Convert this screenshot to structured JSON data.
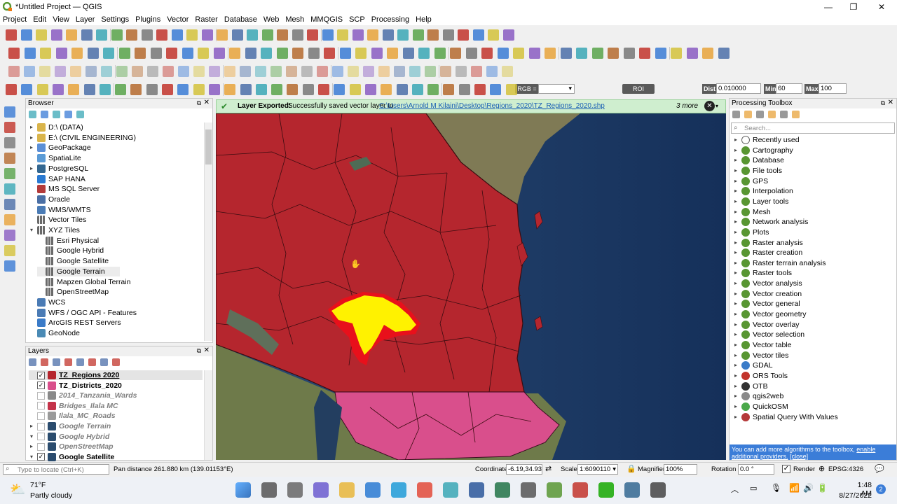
{
  "window": {
    "title": "*Untitled Project — QGIS",
    "minimize": "—",
    "maximize": "❐",
    "close": "✕"
  },
  "menu": [
    "Project",
    "Edit",
    "View",
    "Layer",
    "Settings",
    "Plugins",
    "Vector",
    "Raster",
    "Database",
    "Web",
    "Mesh",
    "MMQGIS",
    "SCP",
    "Processing",
    "Help"
  ],
  "toolbar": {
    "rgb_label": "RGB =",
    "roi_label": "ROI",
    "dist_label": "Dist",
    "dist_value": "0.010000",
    "min_label": "Min",
    "min_value": "60",
    "max_label": "Max",
    "max_value": "100"
  },
  "browser": {
    "title": "Browser",
    "items": [
      {
        "label": "D:\\ (DATA)",
        "icon": "folder-icon",
        "arrow": "▸",
        "indent": 0
      },
      {
        "label": "E:\\ (CIVIL ENGINEERING)",
        "icon": "folder-icon",
        "arrow": "▸",
        "indent": 0
      },
      {
        "label": "GeoPackage",
        "icon": "geopackage-icon",
        "arrow": "▸",
        "indent": 0
      },
      {
        "label": "SpatiaLite",
        "icon": "spatialite-icon",
        "arrow": "",
        "indent": 0
      },
      {
        "label": "PostgreSQL",
        "icon": "postgresql-icon",
        "arrow": "▸",
        "indent": 0
      },
      {
        "label": "SAP HANA",
        "icon": "sap-hana-icon",
        "arrow": "",
        "indent": 0
      },
      {
        "label": "MS SQL Server",
        "icon": "mssql-icon",
        "arrow": "",
        "indent": 0
      },
      {
        "label": "Oracle",
        "icon": "oracle-icon",
        "arrow": "",
        "indent": 0
      },
      {
        "label": "WMS/WMTS",
        "icon": "wms-icon",
        "arrow": "",
        "indent": 0
      },
      {
        "label": "Vector Tiles",
        "icon": "vector-tiles-icon",
        "arrow": "",
        "indent": 0
      },
      {
        "label": "XYZ Tiles",
        "icon": "xyz-tiles-icon",
        "arrow": "▾",
        "indent": 0
      },
      {
        "label": "Esri Physical",
        "icon": "tile-grid-icon",
        "arrow": "",
        "indent": 1
      },
      {
        "label": "Google Hybrid",
        "icon": "tile-grid-icon",
        "arrow": "",
        "indent": 1
      },
      {
        "label": "Google Satellite",
        "icon": "tile-grid-icon",
        "arrow": "",
        "indent": 1
      },
      {
        "label": "Google Terrain",
        "icon": "tile-grid-icon",
        "arrow": "",
        "indent": 1
      },
      {
        "label": "Mapzen Global Terrain",
        "icon": "tile-grid-icon",
        "arrow": "",
        "indent": 1
      },
      {
        "label": "OpenStreetMap",
        "icon": "tile-grid-icon",
        "arrow": "",
        "indent": 1
      },
      {
        "label": "WCS",
        "icon": "wcs-icon",
        "arrow": "",
        "indent": 0
      },
      {
        "label": "WFS / OGC API - Features",
        "icon": "wfs-icon",
        "arrow": "",
        "indent": 0
      },
      {
        "label": "ArcGIS REST Servers",
        "icon": "arcgis-icon",
        "arrow": "",
        "indent": 0
      },
      {
        "label": "GeoNode",
        "icon": "geonode-icon",
        "arrow": "",
        "indent": 0
      }
    ]
  },
  "layers": {
    "title": "Layers",
    "items": [
      {
        "label": "TZ_Regions 2020",
        "checked": true,
        "bold": true,
        "italic": false,
        "color": "#b5262e",
        "arrow": ""
      },
      {
        "label": "TZ_Districts_2020",
        "checked": true,
        "bold": true,
        "italic": false,
        "color": "#d94f8c",
        "arrow": ""
      },
      {
        "label": "2014_Tanzania_Wards",
        "checked": false,
        "bold": true,
        "italic": true,
        "color": "#8a8a8a",
        "arrow": ""
      },
      {
        "label": "Bridges_Ilala MC",
        "checked": false,
        "bold": true,
        "italic": true,
        "color": "#c4334a",
        "arrow": ""
      },
      {
        "label": "Ilala_MC_Roads",
        "checked": false,
        "bold": true,
        "italic": true,
        "color": "#9a9a9a",
        "arrow": ""
      },
      {
        "label": "Google Terrain",
        "checked": false,
        "bold": true,
        "italic": true,
        "color": "#2b4c6e",
        "arrow": "▸"
      },
      {
        "label": "Google Hybrid",
        "checked": false,
        "bold": true,
        "italic": true,
        "color": "#2b4c6e",
        "arrow": "▾"
      },
      {
        "label": "OpenStreetMap",
        "checked": false,
        "bold": true,
        "italic": true,
        "color": "#2b4c6e",
        "arrow": "▸"
      },
      {
        "label": "Google Satellite",
        "checked": true,
        "bold": true,
        "italic": false,
        "color": "#2b4c6e",
        "arrow": "▾"
      }
    ]
  },
  "message": {
    "title": "Layer Exported:",
    "text": "Successfully saved vector layer to",
    "link": "C:\\Users\\Arnold M Kilaini\\Desktop\\Regions_2020\\TZ_Regions_2020.shp",
    "more": "3 more"
  },
  "processing": {
    "title": "Processing Toolbox",
    "search_placeholder": "Search...",
    "items": [
      {
        "label": "Recently used",
        "icon": "clock-icon"
      },
      {
        "label": "Cartography",
        "icon": "qgis-icon"
      },
      {
        "label": "Database",
        "icon": "qgis-icon"
      },
      {
        "label": "File tools",
        "icon": "qgis-icon"
      },
      {
        "label": "GPS",
        "icon": "qgis-icon"
      },
      {
        "label": "Interpolation",
        "icon": "qgis-icon"
      },
      {
        "label": "Layer tools",
        "icon": "qgis-icon"
      },
      {
        "label": "Mesh",
        "icon": "qgis-icon"
      },
      {
        "label": "Network analysis",
        "icon": "qgis-icon"
      },
      {
        "label": "Plots",
        "icon": "qgis-icon"
      },
      {
        "label": "Raster analysis",
        "icon": "qgis-icon"
      },
      {
        "label": "Raster creation",
        "icon": "qgis-icon"
      },
      {
        "label": "Raster terrain analysis",
        "icon": "qgis-icon"
      },
      {
        "label": "Raster tools",
        "icon": "qgis-icon"
      },
      {
        "label": "Vector analysis",
        "icon": "qgis-icon"
      },
      {
        "label": "Vector creation",
        "icon": "qgis-icon"
      },
      {
        "label": "Vector general",
        "icon": "qgis-icon"
      },
      {
        "label": "Vector geometry",
        "icon": "qgis-icon"
      },
      {
        "label": "Vector overlay",
        "icon": "qgis-icon"
      },
      {
        "label": "Vector selection",
        "icon": "qgis-icon"
      },
      {
        "label": "Vector table",
        "icon": "qgis-icon"
      },
      {
        "label": "Vector tiles",
        "icon": "qgis-icon"
      },
      {
        "label": "GDAL",
        "icon": "gdal-icon"
      },
      {
        "label": "ORS Tools",
        "icon": "ors-icon"
      },
      {
        "label": "OTB",
        "icon": "otb-icon"
      },
      {
        "label": "qgis2web",
        "icon": "qgis2web-icon"
      },
      {
        "label": "QuickOSM",
        "icon": "quickosm-icon"
      },
      {
        "label": "Spatial Query With Values",
        "icon": "spatial-query-icon"
      }
    ],
    "info_text": "You can add more algorithms to the toolbox,",
    "info_link": "enable additional providers.",
    "info_close": "[close]"
  },
  "status": {
    "locate_placeholder": "Type to locate (Ctrl+K)",
    "message": "Pan distance 261.880 km (139.01153°E)",
    "coordinate_label": "Coordinate",
    "coordinate": "-6.19,34.93",
    "scale_label": "Scale",
    "scale": "1:6090110",
    "magnifier_label": "Magnifier",
    "magnifier": "100%",
    "rotation_label": "Rotation",
    "rotation": "0.0 °",
    "render_label": "Render",
    "crs": "EPSG:4326"
  },
  "taskbar": {
    "temp": "71°F",
    "weather": "Partly cloudy",
    "time": "1:48 AM",
    "date": "8/27/2022",
    "notifications": "2"
  },
  "colors": {
    "regions": "#b5262e",
    "districts": "#d94f8c",
    "highlight_yellow": "#fff200",
    "highlight_red": "#e8101b",
    "ocean": "#1d3a63"
  }
}
